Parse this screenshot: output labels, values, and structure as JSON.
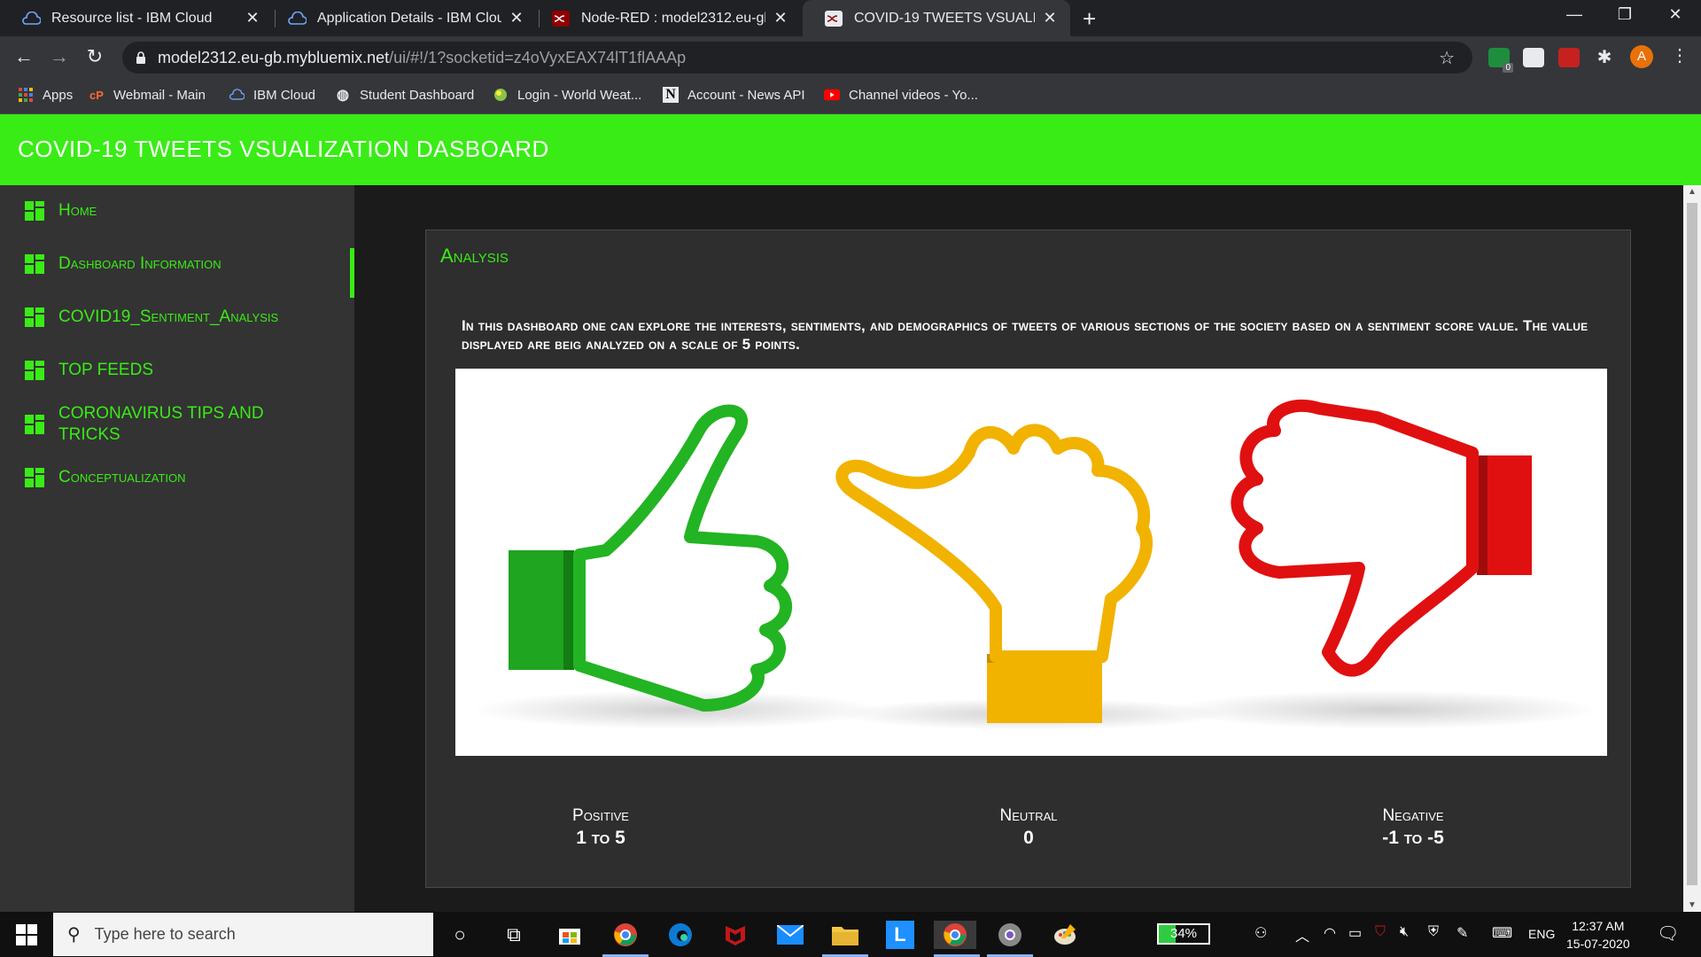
{
  "browser": {
    "tabs": [
      {
        "title": "Resource list - IBM Cloud",
        "active": false
      },
      {
        "title": "Application Details - IBM Cloud",
        "active": false
      },
      {
        "title": "Node-RED : model2312.eu-gb.my",
        "active": false
      },
      {
        "title": "COVID-19 TWEETS VSUALIZATIO",
        "active": true
      }
    ],
    "url_host": "model2312.eu-gb.mybluemix.net",
    "url_path": "/ui/#!/1?socketid=z4oVyxEAX74lT1flAAAp",
    "avatar_letter": "A",
    "extension_badge": "0",
    "bookmarks": [
      {
        "label": "Apps",
        "icon": "apps-grid-icon"
      },
      {
        "label": "Webmail - Main",
        "icon": "cpanel-icon"
      },
      {
        "label": "IBM Cloud",
        "icon": "ibm-cloud-icon"
      },
      {
        "label": "Student Dashboard",
        "icon": "globe-icon"
      },
      {
        "label": "Login - World Weat...",
        "icon": "weather-icon"
      },
      {
        "label": "Account - News API",
        "icon": "news-api-icon"
      },
      {
        "label": "Channel videos - Yo...",
        "icon": "youtube-icon"
      }
    ]
  },
  "app": {
    "title": "COVID-19 TWEETS VSUALIZATION DASBOARD",
    "accent": "#39ec16",
    "nav": [
      {
        "label": "Home",
        "active": false
      },
      {
        "label": "Dashboard Information",
        "active": true
      },
      {
        "label": "COVID19_Sentiment_Analysis",
        "active": false
      },
      {
        "label": "TOP FEEDS",
        "active": false
      },
      {
        "label": "CORONAVIRUS TIPS AND TRICKS",
        "active": false
      },
      {
        "label": "Conceptualization",
        "active": false
      }
    ],
    "card": {
      "title": "Analysis",
      "description": "In this dashboard one can explore the interests, sentiments, and demographics of tweets of various sections of the society based on a sentiment score value. The value displayed are beig analyzed on a scale of 5 points.",
      "image": "sentiment thumbs: green thumbs-up, yellow sideways thumb, red thumbs-down",
      "stats": [
        {
          "label": "Positive",
          "value": "1 to 5",
          "color": "#1eb41e"
        },
        {
          "label": "Neutral",
          "value": "0",
          "color": "#f2b200"
        },
        {
          "label": "Negative",
          "value": "-1 to -5",
          "color": "#e01010"
        }
      ]
    }
  },
  "taskbar": {
    "search_placeholder": "Type here to search",
    "battery": "34%",
    "language": "ENG",
    "time": "12:37 AM",
    "date": "15-07-2020"
  }
}
